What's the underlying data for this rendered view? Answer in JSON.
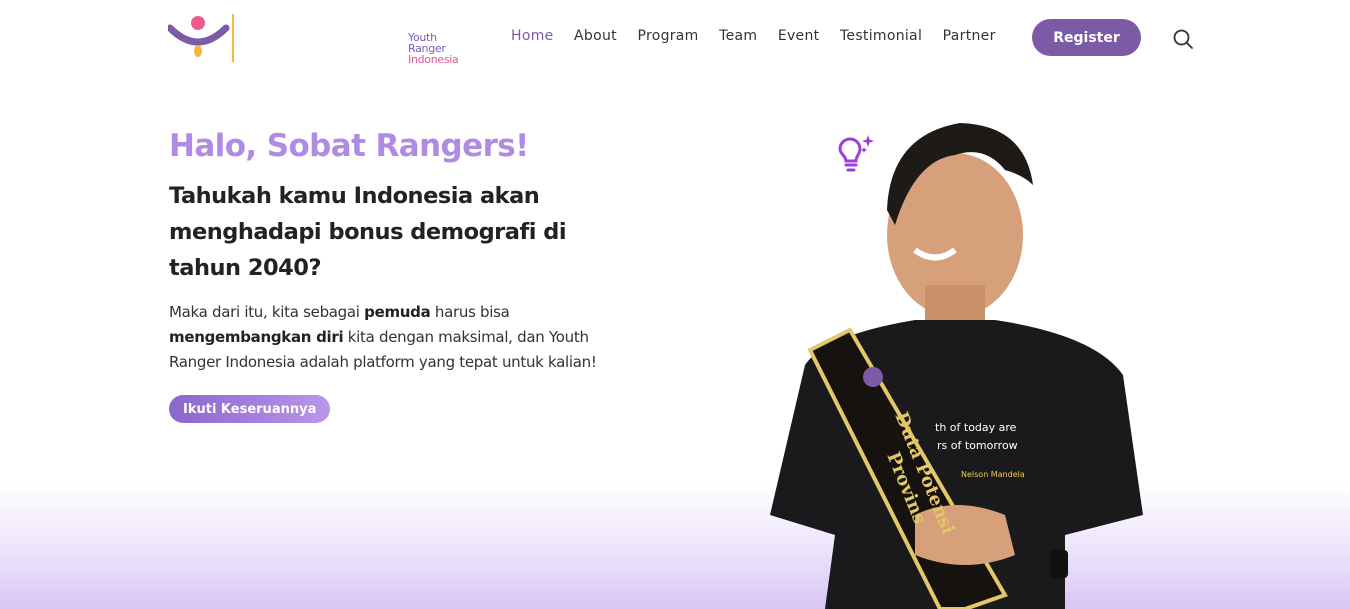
{
  "header": {
    "logo": {
      "line1": "Youth",
      "line2": "Ranger",
      "line3": "Indonesia"
    },
    "nav": [
      {
        "label": "Home",
        "active": true
      },
      {
        "label": "About"
      },
      {
        "label": "Program"
      },
      {
        "label": "Team"
      },
      {
        "label": "Event"
      },
      {
        "label": "Testimonial"
      },
      {
        "label": "Partner"
      }
    ],
    "register_label": "Register",
    "search_icon": "search-icon"
  },
  "hero": {
    "greeting": "Halo, Sobat Rangers!",
    "headline": "Tahukah kamu Indonesia akan menghadapi bonus demografi di tahun 2040?",
    "body_part1": "Maka dari itu, kita sebagai ",
    "body_bold1": "pemuda",
    "body_part2": " harus bisa ",
    "body_bold2": "mengembangkan diri",
    "body_part3": " kita dengan maksimal, dan Youth Ranger Indonesia adalah platform yang tepat untuk kalian!",
    "cta_label": "Ikuti Keseruannya"
  },
  "photo": {
    "shirt_text1": "th of today are",
    "shirt_text2": "rs of tomorrow",
    "shirt_text3": "Nelson Mandela",
    "sash_text1": "Duta Potensi",
    "sash_text2": "Provins"
  },
  "colors": {
    "accent": "#7b5aa6",
    "greeting": "#b08be3",
    "bottom_fade": "#d9c6f5"
  }
}
